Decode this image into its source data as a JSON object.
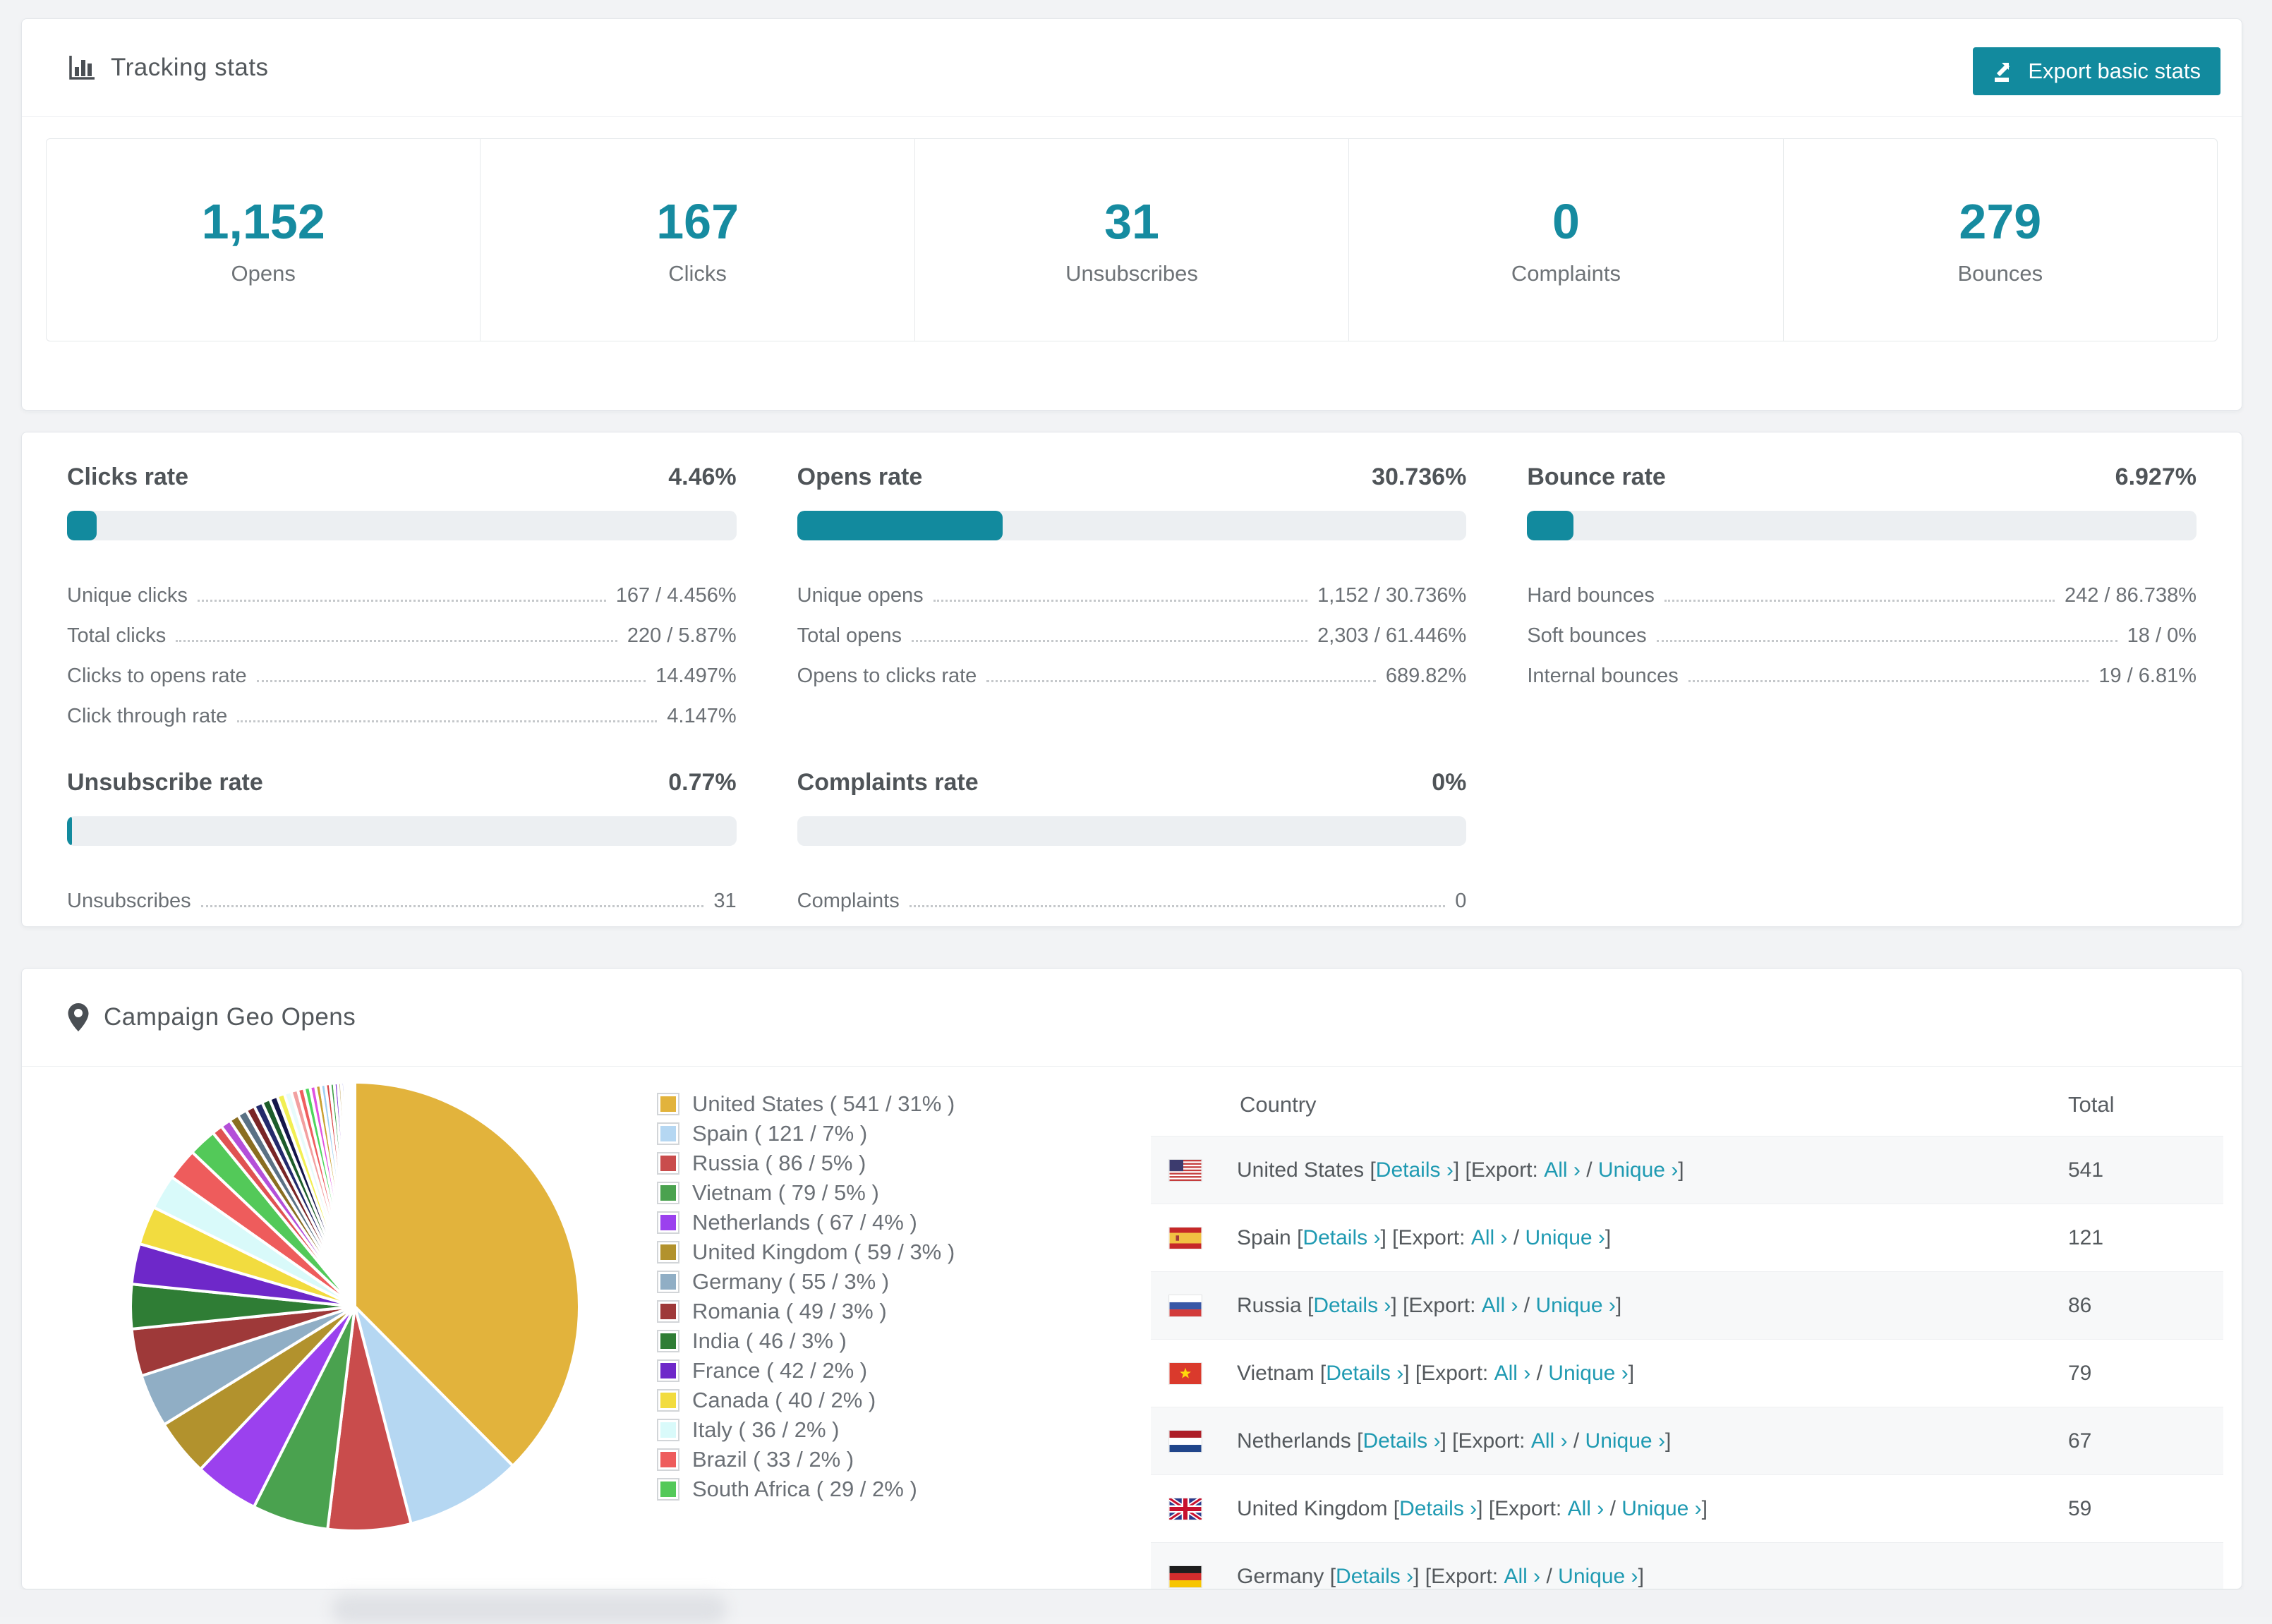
{
  "colors": {
    "accent_teal": "#128a9e",
    "stat_number": "#168ba0",
    "link": "#1f9ab2",
    "bar_track": "#eceff2"
  },
  "tracking": {
    "title": "Tracking stats",
    "export_button": "Export basic stats",
    "stats": [
      {
        "value": "1,152",
        "label": "Opens"
      },
      {
        "value": "167",
        "label": "Clicks"
      },
      {
        "value": "31",
        "label": "Unsubscribes"
      },
      {
        "value": "0",
        "label": "Complaints"
      },
      {
        "value": "279",
        "label": "Bounces"
      }
    ]
  },
  "rates": {
    "blocks": [
      {
        "title": "Clicks rate",
        "value": "4.46%",
        "pct": 4.46,
        "rows": [
          {
            "label": "Unique clicks",
            "value": "167 / 4.456%"
          },
          {
            "label": "Total clicks",
            "value": "220 / 5.87%"
          },
          {
            "label": "Clicks to opens rate",
            "value": "14.497%"
          },
          {
            "label": "Click through rate",
            "value": "4.147%"
          }
        ]
      },
      {
        "title": "Opens rate",
        "value": "30.736%",
        "pct": 30.736,
        "rows": [
          {
            "label": "Unique opens",
            "value": "1,152 / 30.736%"
          },
          {
            "label": "Total opens",
            "value": "2,303 / 61.446%"
          },
          {
            "label": "Opens to clicks rate",
            "value": "689.82%"
          }
        ]
      },
      {
        "title": "Bounce rate",
        "value": "6.927%",
        "pct": 6.927,
        "rows": [
          {
            "label": "Hard bounces",
            "value": "242 / 86.738%"
          },
          {
            "label": "Soft bounces",
            "value": "18 / 0%"
          },
          {
            "label": "Internal bounces",
            "value": "19 / 6.81%"
          }
        ]
      },
      {
        "title": "Unsubscribe rate",
        "value": "0.77%",
        "pct": 0.77,
        "rows": [
          {
            "label": "Unsubscribes",
            "value": "31"
          }
        ]
      },
      {
        "title": "Complaints rate",
        "value": "0%",
        "pct": 0,
        "rows": [
          {
            "label": "Complaints",
            "value": "0"
          }
        ]
      }
    ]
  },
  "geo": {
    "title": "Campaign Geo Opens",
    "table": {
      "headers": [
        "Country",
        "Total"
      ],
      "details_label": "Details ›",
      "export_label": "Export:",
      "all_label": "All ›",
      "unique_label": "Unique ›",
      "rows": [
        {
          "country": "United States",
          "flag": "us",
          "total": "541"
        },
        {
          "country": "Spain",
          "flag": "es",
          "total": "121"
        },
        {
          "country": "Russia",
          "flag": "ru",
          "total": "86"
        },
        {
          "country": "Vietnam",
          "flag": "vn",
          "total": "79"
        },
        {
          "country": "Netherlands",
          "flag": "nl",
          "total": "67"
        },
        {
          "country": "United Kingdom",
          "flag": "gb",
          "total": "59"
        },
        {
          "country": "Germany",
          "flag": "de",
          "total": ""
        }
      ]
    }
  },
  "chart_data": {
    "type": "pie",
    "title": "Campaign Geo Opens",
    "legend_position": "right",
    "start_angle_deg": -90,
    "direction": "clockwise",
    "slices": [
      {
        "label": "United States",
        "value": 541,
        "pct_label": "31%",
        "color": "#e2b33c"
      },
      {
        "label": "Spain",
        "value": 121,
        "pct_label": "7%",
        "color": "#b5d7f2"
      },
      {
        "label": "Russia",
        "value": 86,
        "pct_label": "5%",
        "color": "#c94c4c"
      },
      {
        "label": "Vietnam",
        "value": 79,
        "pct_label": "5%",
        "color": "#4aa24f"
      },
      {
        "label": "Netherlands",
        "value": 67,
        "pct_label": "4%",
        "color": "#9b41ee"
      },
      {
        "label": "United Kingdom",
        "value": 59,
        "pct_label": "3%",
        "color": "#b2922d"
      },
      {
        "label": "Germany",
        "value": 55,
        "pct_label": "3%",
        "color": "#90aec5"
      },
      {
        "label": "Romania",
        "value": 49,
        "pct_label": "3%",
        "color": "#9e3939"
      },
      {
        "label": "India",
        "value": 46,
        "pct_label": "3%",
        "color": "#2f7d35"
      },
      {
        "label": "France",
        "value": 42,
        "pct_label": "2%",
        "color": "#6e28c9"
      },
      {
        "label": "Canada",
        "value": 40,
        "pct_label": "2%",
        "color": "#f2dc3f"
      },
      {
        "label": "Italy",
        "value": 36,
        "pct_label": "2%",
        "color": "#d9fafa"
      },
      {
        "label": "Brazil",
        "value": 33,
        "pct_label": "2%",
        "color": "#ee5c5c"
      },
      {
        "label": "South Africa",
        "value": 29,
        "pct_label": "2%",
        "color": "#53c959"
      }
    ],
    "others": {
      "estimated_total": 157
    }
  }
}
